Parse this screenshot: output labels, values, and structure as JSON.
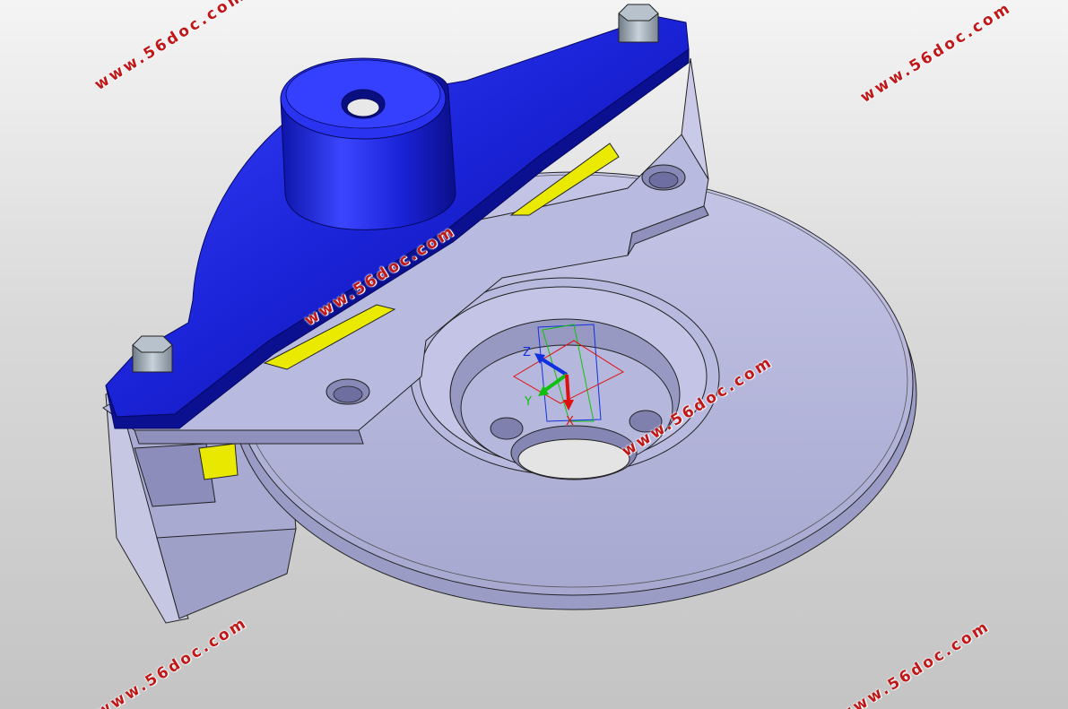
{
  "watermark": {
    "text": "www.56doc.com",
    "color": "#c01818"
  },
  "triad": {
    "x_label": "X",
    "y_label": "Y",
    "z_label": "Z",
    "x_color": "#e01010",
    "y_color": "#10c010",
    "z_color": "#1030e0"
  },
  "parts": {
    "upper_arm_color": "#1a22d6",
    "housing_color": "#b3b4d8",
    "disc_color": "#aeafd6",
    "pad_color": "#f0f000",
    "bolt_color": "#9aa6b0"
  }
}
